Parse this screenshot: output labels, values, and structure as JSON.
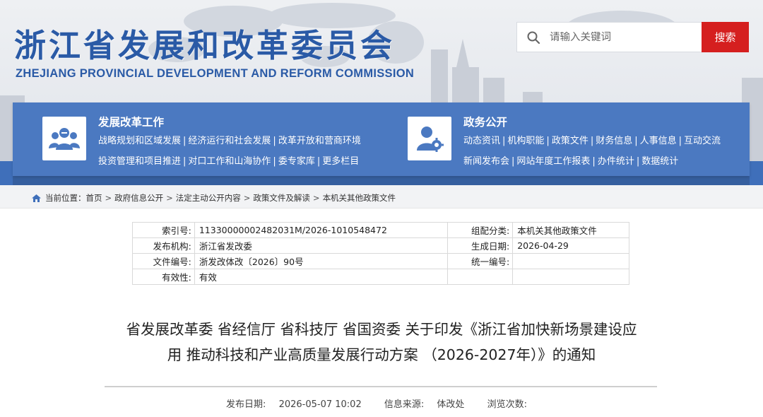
{
  "site": {
    "name_cn": "浙江省发展和改革委员会",
    "name_en": "ZHEJIANG PROVINCIAL DEVELOPMENT AND REFORM COMMISSION"
  },
  "search": {
    "placeholder": "请输入关键词",
    "button_label": "搜索"
  },
  "nav": {
    "left": {
      "title": "发展改革工作",
      "icon": "people-group-icon",
      "rows": [
        [
          "战略规划和区域发展",
          "经济运行和社会发展",
          "改革开放和营商环境"
        ],
        [
          "投资管理和项目推进",
          "对口工作和山海协作",
          "委专家库",
          "更多栏目"
        ]
      ]
    },
    "right": {
      "title": "政务公开",
      "icon": "user-gear-icon",
      "rows": [
        [
          "动态资讯",
          "机构职能",
          "政策文件",
          "财务信息",
          "人事信息",
          "互动交流"
        ],
        [
          "新闻发布会",
          "网站年度工作报表",
          "办件统计",
          "数据统计"
        ]
      ]
    },
    "separator": "|"
  },
  "breadcrumb": {
    "prefix": "当前位置：",
    "items": [
      "首页",
      "政府信息公开",
      "法定主动公开内容",
      "政策文件及解读",
      "本机关其他政策文件"
    ],
    "separator": ">"
  },
  "info": {
    "rows": [
      {
        "l1": "索引号:",
        "v1": "11330000002482031M/2026-1010548472",
        "l2": "组配分类:",
        "v2": "本机关其他政策文件"
      },
      {
        "l1": "发布机构:",
        "v1": "浙江省发改委",
        "l2": "生成日期:",
        "v2": "2026-04-29"
      },
      {
        "l1": "文件编号:",
        "v1": "浙发改体改〔2026〕90号",
        "l2": "统一编号:",
        "v2": ""
      },
      {
        "l1": "有效性:",
        "v1": "有效",
        "l2": "",
        "v2": ""
      }
    ]
  },
  "document": {
    "title_line1": "省发展改革委 省经信厅 省科技厅 省国资委 关于印发《浙江省加快新场景建设应",
    "title_line2": "用 推动科技和产业高质量发展行动方案 （2026-2027年）》的通知",
    "publish_date_label": "发布日期:",
    "publish_date": "2026-05-07 10:02",
    "source_label": "信息来源:",
    "source": "体改处",
    "views_label": "浏览次数:",
    "views": ""
  },
  "colors": {
    "brand_blue": "#2a5aa6",
    "nav_blue": "#4b79c1",
    "search_red": "#d51f1f"
  }
}
